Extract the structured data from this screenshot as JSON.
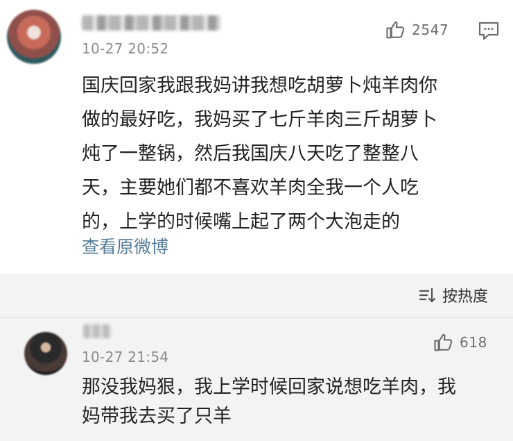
{
  "main_comment": {
    "timestamp": "10-27 20:52",
    "like_count": "2547",
    "text": "国庆回家我跟我妈讲我想吃胡萝卜炖羊肉你\n做的最好吃，我妈买了七斤羊肉三斤胡萝卜\n炖了一整锅，然后我国庆八天吃了整整八\n天，主要她们都不喜欢羊肉全我一个人吃\n的，上学的时候嘴上起了两个大泡走的",
    "view_original_label": "查看原微博",
    "icons": {
      "avatar": "avatar-image",
      "like": "thumbs-up-icon",
      "comment": "comment-icon"
    }
  },
  "replies": {
    "sort_label": "按热度",
    "sort_icon": "sort-icon",
    "items": [
      {
        "timestamp": "10-27 21:54",
        "like_count": "618",
        "text": "那没我妈狠，我上学时候回家说想吃羊肉，我\n妈带我去买了只羊"
      }
    ]
  },
  "colors": {
    "link": "#557c99",
    "meta": "#8b8b8b",
    "replies_bg": "#f3f3f3",
    "text": "#222222"
  }
}
